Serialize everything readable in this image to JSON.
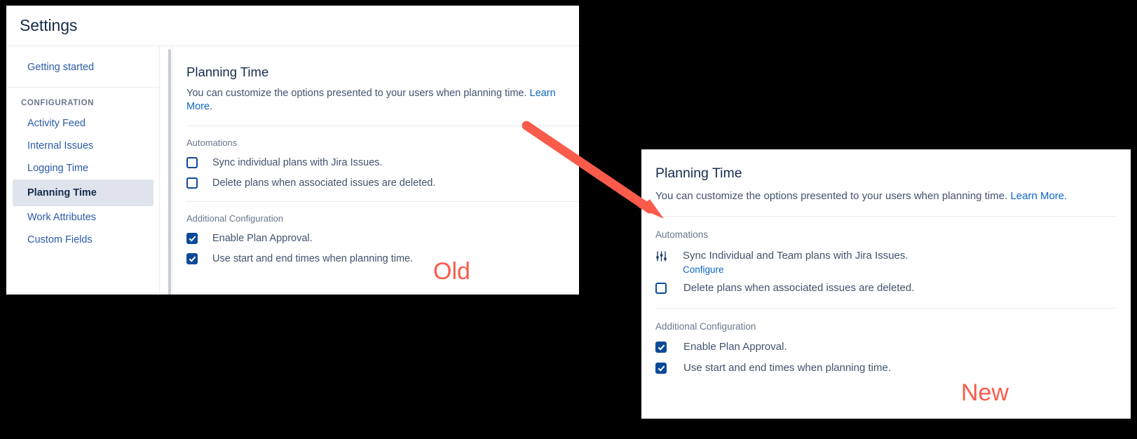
{
  "annotations": {
    "old_label": "Old",
    "new_label": "New",
    "arrow_color": "#fa5b4b",
    "label_color": "#fa5b4b"
  },
  "old_panel": {
    "header": {
      "title": "Settings"
    },
    "sidebar": {
      "top_item": {
        "label": "Getting started"
      },
      "section_label": "CONFIGURATION",
      "items": [
        {
          "label": "Activity Feed",
          "selected": false
        },
        {
          "label": "Internal Issues",
          "selected": false
        },
        {
          "label": "Logging Time",
          "selected": false
        },
        {
          "label": "Planning Time",
          "selected": true
        },
        {
          "label": "Work Attributes",
          "selected": false
        },
        {
          "label": "Custom Fields",
          "selected": false
        }
      ]
    },
    "content": {
      "title": "Planning Time",
      "description": "You can customize the options presented to your users when planning time.",
      "learn_more": "Learn More.",
      "automations_label": "Automations",
      "automations": [
        {
          "label": "Sync individual plans with Jira Issues.",
          "checked": false
        },
        {
          "label": "Delete plans when associated issues are deleted.",
          "checked": false
        }
      ],
      "additional_label": "Additional Configuration",
      "additional": [
        {
          "label": "Enable Plan Approval.",
          "checked": true
        },
        {
          "label": "Use start and end times when planning time.",
          "checked": true
        }
      ]
    }
  },
  "new_panel": {
    "content": {
      "title": "Planning Time",
      "description": "You can customize the options presented to your users when planning time.",
      "learn_more": "Learn More.",
      "automations_label": "Automations",
      "sync_row": {
        "icon": "sliders-icon",
        "label": "Sync Individual and Team plans with Jira Issues.",
        "configure_link": "Configure"
      },
      "automations": [
        {
          "label": "Delete plans when associated issues are deleted.",
          "checked": false
        }
      ],
      "additional_label": "Additional Configuration",
      "additional": [
        {
          "label": "Enable Plan Approval.",
          "checked": true
        },
        {
          "label": "Use start and end times when planning time.",
          "checked": true
        }
      ]
    }
  },
  "colors": {
    "checkbox_checked": "#0b4a9a",
    "link": "#0c66c7",
    "sidebar_link": "#2b5ba8",
    "selected_bg": "#dfe3ec",
    "text": "#42526e",
    "heading": "#172b4d"
  }
}
